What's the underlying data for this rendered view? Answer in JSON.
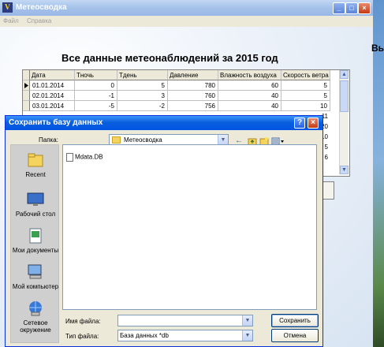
{
  "main_window": {
    "icon_letter": "V",
    "title": "Метеосводка",
    "menu": [
      "Файл",
      "Справка"
    ],
    "heading": "Все данные метеонаблюдений за 2015 год",
    "side_label": "Вы"
  },
  "grid": {
    "columns": [
      "Дата",
      "Тночь",
      "Тдень",
      "Давление",
      "Влажность воздуха",
      "Скорость ветра"
    ],
    "rows": [
      [
        "01.01.2014",
        "0",
        "5",
        "780",
        "60",
        "5"
      ],
      [
        "02.01.2014",
        "-1",
        "3",
        "760",
        "40",
        "5"
      ],
      [
        "03.01.2014",
        "-5",
        "-2",
        "756",
        "40",
        "10"
      ]
    ],
    "hidden_tail_values": [
      "11",
      "20",
      "10",
      "5",
      "6"
    ]
  },
  "dialog": {
    "title": "Сохранить базу данных",
    "folder_label": "Папка:",
    "folder_value": "Метеосводка",
    "places": [
      "Recent",
      "Рабочий стол",
      "Мои документы",
      "Мой компьютер",
      "Сетевое окружение"
    ],
    "files": [
      "Mdata.DB"
    ],
    "filename_label": "Имя файла:",
    "filename_value": "",
    "filetype_label": "Тип файла:",
    "filetype_value": "База данных *db",
    "save_label": "Сохранить",
    "cancel_label": "Отмена"
  }
}
